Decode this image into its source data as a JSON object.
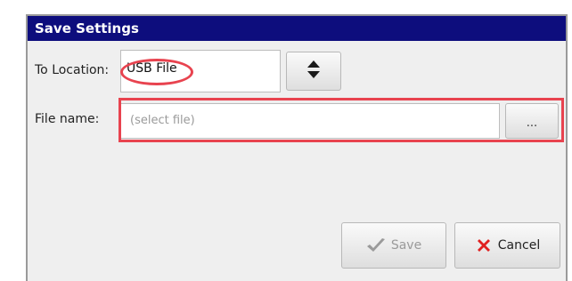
{
  "dialog": {
    "title": "Save Settings"
  },
  "location": {
    "label": "To Location:",
    "value": "USB File",
    "spin_icon": "up-down-arrows-icon"
  },
  "filename": {
    "label": "File name:",
    "placeholder": "(select file)",
    "browse_label": "..."
  },
  "buttons": {
    "save_label": "Save",
    "save_icon": "checkmark-icon",
    "cancel_label": "Cancel",
    "cancel_icon": "x-icon"
  },
  "colors": {
    "titlebar": "#0d0d7d",
    "annotation": "#e8434f",
    "cancel_icon": "#e02020",
    "save_icon_disabled": "#9a9a9a"
  }
}
